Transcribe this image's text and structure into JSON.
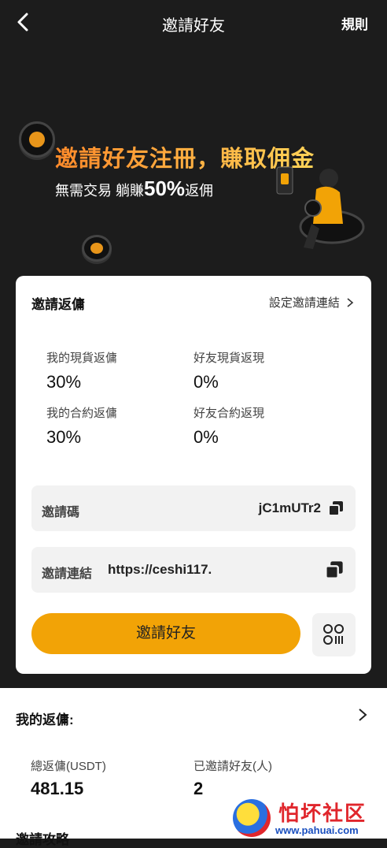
{
  "header": {
    "title": "邀請好友",
    "rules_label": "規則"
  },
  "banner": {
    "headline": "邀請好友注冊，賺取佣金",
    "sub_prefix": "無需交易 躺賺",
    "sub_highlight": "50%",
    "sub_suffix": "返佣"
  },
  "invite_rebate": {
    "title": "邀請返傭",
    "settings_link": "設定邀請連結",
    "stats": [
      {
        "label": "我的現貨返傭",
        "value": "30%"
      },
      {
        "label": "好友現貨返現",
        "value": "0%"
      },
      {
        "label": "我的合約返傭",
        "value": "30%"
      },
      {
        "label": "好友合約返現",
        "value": "0%"
      }
    ],
    "invite_code_label": "邀請碼",
    "invite_code": "jC1mUTr2",
    "invite_link_label": "邀請連結",
    "invite_link": "https://ceshi117.",
    "invite_button": "邀請好友"
  },
  "my_rebate": {
    "title": "我的返傭:",
    "total_label": "總返傭(USDT)",
    "total_value": "481.15",
    "invited_label": "已邀請好友(人)",
    "invited_value": "2",
    "next_section_title": "邀請攻略"
  },
  "watermark": {
    "text": "怕坏社区",
    "url": "www.pahuai.com"
  },
  "colors": {
    "accent": "#f2a306",
    "background": "#1c1c1c",
    "card": "#ffffff"
  }
}
